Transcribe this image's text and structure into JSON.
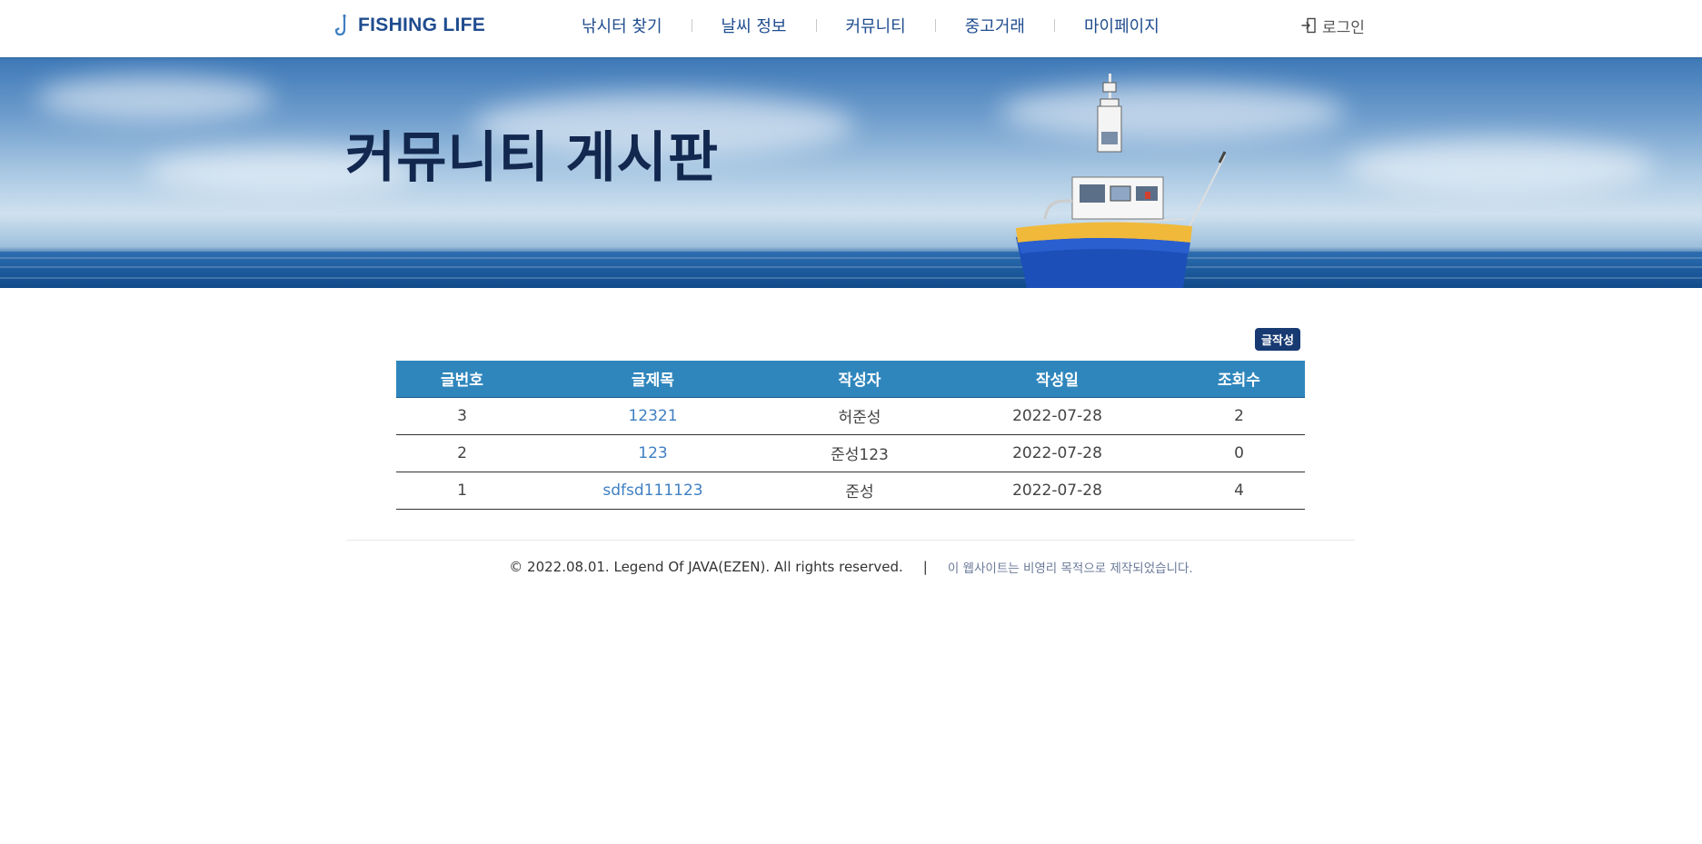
{
  "header": {
    "logo_text": "FISHING LIFE",
    "nav": [
      {
        "label": "낚시터 찾기"
      },
      {
        "label": "날씨 정보"
      },
      {
        "label": "커뮤니티"
      },
      {
        "label": "중고거래"
      },
      {
        "label": "마이페이지"
      }
    ],
    "login_label": "로그인"
  },
  "banner": {
    "title": "커뮤니티 게시판"
  },
  "board": {
    "write_button_label": "글작성",
    "columns": [
      "글번호",
      "글제목",
      "작성자",
      "작성일",
      "조회수"
    ],
    "rows": [
      {
        "no": "3",
        "title": "12321",
        "author": "허준성",
        "date": "2022-07-28",
        "views": "2"
      },
      {
        "no": "2",
        "title": "123",
        "author": "준성123",
        "date": "2022-07-28",
        "views": "0"
      },
      {
        "no": "1",
        "title": "sdfsd111123",
        "author": "준성",
        "date": "2022-07-28",
        "views": "4"
      }
    ]
  },
  "footer": {
    "copyright": "© 2022.08.01.  Legend Of JAVA(EZEN).  All rights reserved.",
    "separator": "|",
    "note": "이 웹사이트는 비영리 목적으로 제작되었습니다."
  },
  "colors": {
    "brand": "#1f4c8f",
    "table_header": "#2f86bc",
    "write_button": "#173a72",
    "link": "#3f7fc2"
  },
  "icons": {
    "logo": "fishing-hook-icon",
    "login": "login-door-icon"
  }
}
